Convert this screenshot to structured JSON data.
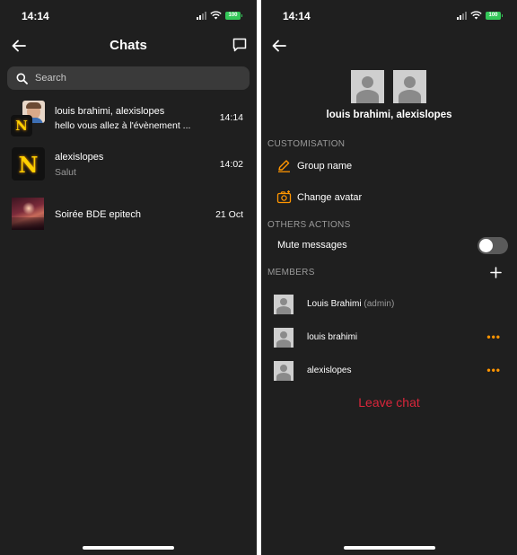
{
  "status_bar": {
    "time": "14:14",
    "battery": "100"
  },
  "chats_screen": {
    "title": "Chats",
    "search_placeholder": "Search",
    "chats": [
      {
        "name": "louis brahimi, alexislopes",
        "last_message": "hello vous allez à l'évènement ...",
        "time": "14:14"
      },
      {
        "name": "alexislopes",
        "last_message": "Salut",
        "time": "14:02"
      },
      {
        "name": "Soirée BDE epitech",
        "last_message": "",
        "time": "21 Oct"
      }
    ],
    "avatar_letter": "N"
  },
  "details_screen": {
    "group_name": "louis brahimi, alexislopes",
    "customisation_header": "CUSTOMISATION",
    "group_name_action": "Group name",
    "change_avatar_action": "Change avatar",
    "others_header": "OTHERS ACTIONS",
    "mute_label": "Mute messages",
    "mute_enabled": false,
    "members_header": "MEMBERS",
    "members": [
      {
        "name": "Louis Brahimi",
        "role": "(admin)"
      },
      {
        "name": "louis brahimi",
        "role": ""
      },
      {
        "name": "alexislopes",
        "role": ""
      }
    ],
    "more_glyph": "•••",
    "leave_label": "Leave chat"
  },
  "colors": {
    "background": "#1f1f1f",
    "accent": "#ff9500",
    "danger": "#d9263b",
    "toggle_off": "#5a5a5a"
  }
}
